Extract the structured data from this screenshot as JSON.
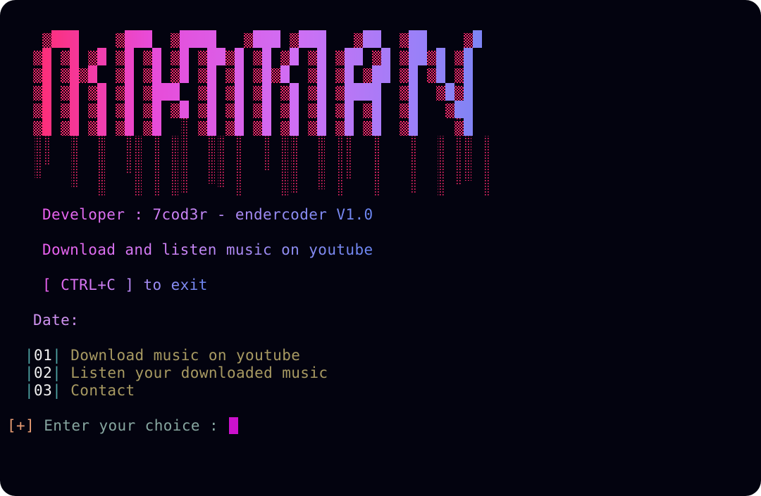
{
  "logo": {
    "letters": [
      "M",
      "P",
      "M",
      "A",
      "N"
    ],
    "gradient": [
      "#ff2a6d",
      "#e84bd8",
      "#cf6ff4",
      "#9a80f8",
      "#6f86f2"
    ]
  },
  "info": {
    "developer_line": "Developer : 7cod3r - endercoder V1.0",
    "tagline": "Download and listen music on youtube",
    "exit_hint": "[ CTRL+C ] to exit",
    "date_label": "Date:"
  },
  "menu": {
    "items": [
      {
        "number": "01",
        "label": "Download music on youtube"
      },
      {
        "number": "02",
        "label": "Listen your downloaded music"
      },
      {
        "number": "03",
        "label": "Contact"
      }
    ]
  },
  "prompt": {
    "marker": "[+]",
    "text": "Enter your choice :"
  },
  "colors": {
    "background": "#03030f",
    "cursor": "#cc11cc",
    "menu_number": "#f2f2f2",
    "menu_label": "#a89a62",
    "pipe": "#4ea3a3",
    "prompt_marker": "#e79b72",
    "prompt_text": "#86a6a0"
  }
}
